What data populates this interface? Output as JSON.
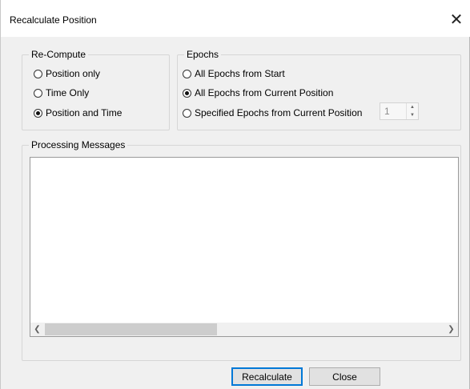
{
  "window": {
    "title": "Recalculate Position",
    "close_glyph": "✕"
  },
  "recompute": {
    "label": "Re-Compute",
    "options": [
      {
        "label": "Position only",
        "selected": false
      },
      {
        "label": "Time Only",
        "selected": false
      },
      {
        "label": "Position and Time",
        "selected": true
      }
    ]
  },
  "epochs": {
    "label": "Epochs",
    "options": [
      {
        "label": "All Epochs from Start",
        "selected": false
      },
      {
        "label": "All Epochs from Current Position",
        "selected": true
      },
      {
        "label": "Specified Epochs from Current Position",
        "selected": false
      }
    ],
    "count_value": "1"
  },
  "messages": {
    "label": "Processing Messages"
  },
  "buttons": {
    "recalculate": "Recalculate",
    "close": "Close"
  },
  "icons": {
    "spin_up": "▲",
    "spin_down": "▼",
    "scroll_left": "❮",
    "scroll_right": "❯"
  }
}
